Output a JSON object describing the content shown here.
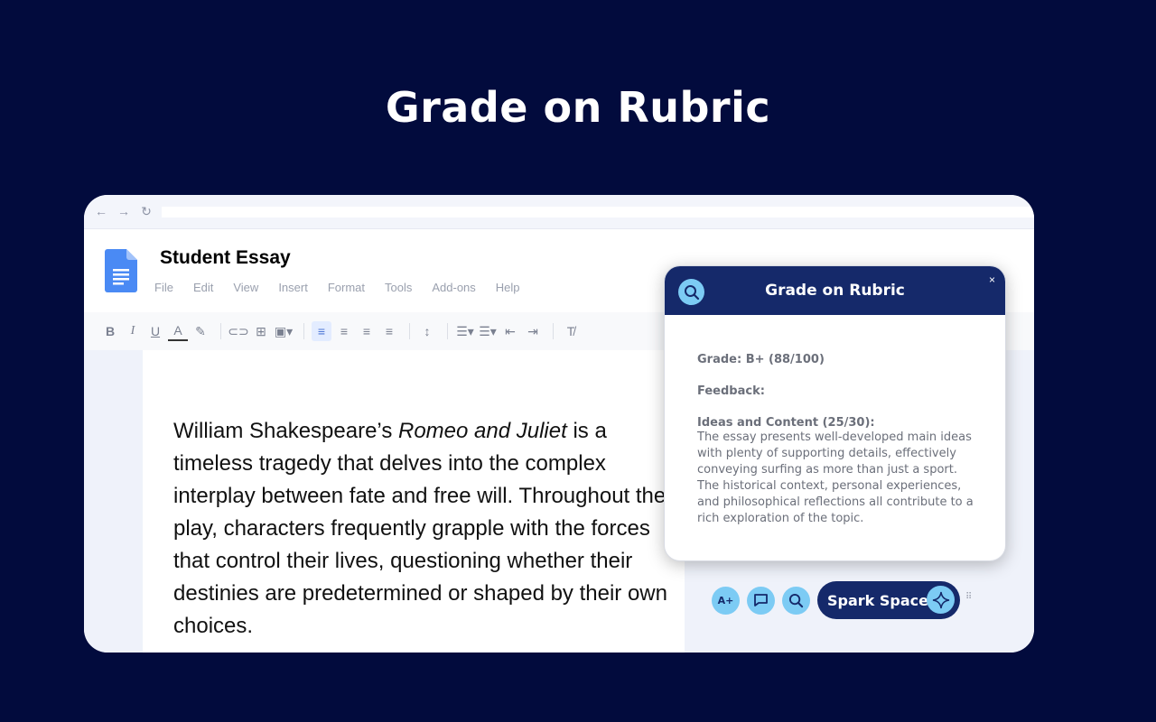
{
  "hero": {
    "title": "Grade on Rubric"
  },
  "document": {
    "title": "Student Essay",
    "menu": [
      "File",
      "Edit",
      "View",
      "Insert",
      "Format",
      "Tools",
      "Add-ons",
      "Help"
    ],
    "essay": {
      "part1": "William Shakespeare’s ",
      "italic": "Romeo and Juliet",
      "part2": " is a timeless tragedy that delves into the complex interplay between fate and free will. Throughout the play, characters frequently grapple with the forces that control their lives, questioning whether their destinies are predetermined or shaped by their own choices."
    }
  },
  "panel": {
    "title": "Grade on Rubric",
    "close": "×",
    "grade": "Grade: B+ (88/100)",
    "feedback_label": "Feedback:",
    "section_title": "Ideas and Content (25/30):",
    "section_text": "The essay presents well-developed main ideas with plenty of supporting details, effectively conveying surfing as more than just a sport. The historical context, personal experiences, and philosophical reflections all contribute to a rich exploration of the topic."
  },
  "bottom_bar": {
    "grade_button": "A+",
    "spark_label": "Spark Space"
  },
  "colors": {
    "background": "#020b3d",
    "panel_header": "#15296a",
    "accent": "#7ccbf4"
  },
  "icons": [
    "back-arrow-icon",
    "forward-arrow-icon",
    "reload-icon",
    "docs-logo-icon",
    "search-icon",
    "comment-icon",
    "sparkle-icon",
    "drag-handle-icon"
  ]
}
